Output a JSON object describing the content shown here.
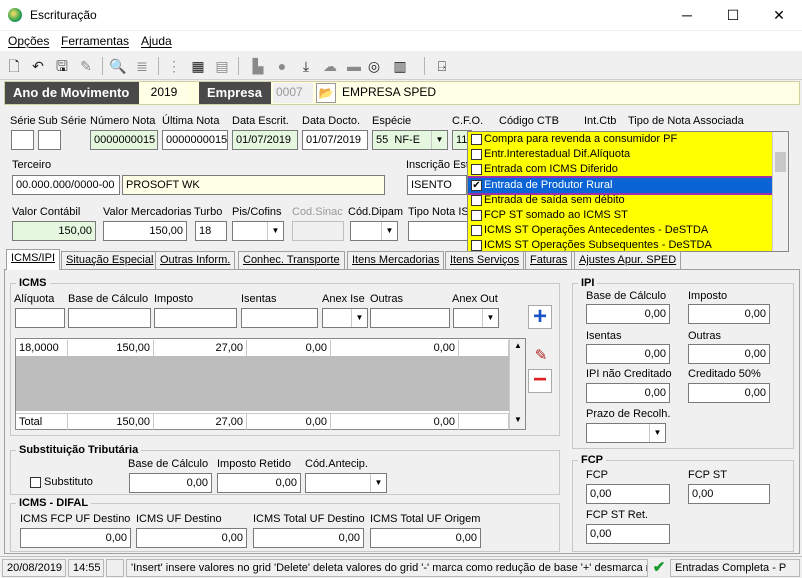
{
  "window": {
    "title": "Escrituração",
    "minimize": "─",
    "maximize": "☐",
    "close": "✕"
  },
  "menu": [
    "Opções",
    "Ferramentas",
    "Ajuda"
  ],
  "year_bar": {
    "ano_label": "Ano de Movimento",
    "ano_value": "2019",
    "empresa_label": "Empresa",
    "empresa_code": "0007",
    "empresa_name": "EMPRESA SPED"
  },
  "header": {
    "serie_label": "Série",
    "subserie_label": "Sub Série",
    "numero_nota_label": "Número Nota",
    "numero_nota": "0000000015",
    "ultima_nota_label": "Última Nota",
    "ultima_nota": "0000000015",
    "data_escrit_label": "Data Escrit.",
    "data_escrit": "01/07/2019",
    "data_docto_label": "Data Docto.",
    "data_docto": "01/07/2019",
    "especie_label": "Espécie",
    "especie_code": "55",
    "especie_name": "NF-E",
    "cfo_label": "C.F.O.",
    "cfo_value": "11",
    "codigo_ctb_label": "Código CTB",
    "int_ctb_label": "Int.Ctb",
    "tipo_nota_label": "Tipo de Nota Associada",
    "terceiro_label": "Terceiro",
    "terceiro_cnpj": "00.000.000/0000-00",
    "terceiro_name": "PROSOFT WK",
    "inscricao_label": "Inscrição Est",
    "inscricao_value": "ISENTO",
    "valor_contabil_label": "Valor Contábil",
    "valor_contabil": "150,00",
    "valor_mercadorias_label": "Valor Mercadorias",
    "valor_mercadorias": "150,00",
    "turbo_label": "Turbo",
    "turbo_value": "18",
    "pis_cofins_label": "Pis/Cofins",
    "cod_sinac_label": "Cod.Sinac",
    "cod_dipam_label": "Cód.Dipam",
    "tipo_nota_is_label": "Tipo Nota IS"
  },
  "dropdown": {
    "items": [
      {
        "label": "Compra para revenda a consumidor PF",
        "checked": false
      },
      {
        "label": "Entr.Interestadual Dif.Alíquota",
        "checked": false
      },
      {
        "label": "Entrada com ICMS Diferido",
        "checked": false
      },
      {
        "label": "Entrada de Produtor Rural",
        "checked": true,
        "selected": true
      },
      {
        "label": "Entrada de saída sem débito",
        "checked": false
      },
      {
        "label": "FCP ST somado ao ICMS ST",
        "checked": false
      },
      {
        "label": "ICMS ST Operações Antecedentes - DeSTDA",
        "checked": false
      },
      {
        "label": "ICMS ST Operações Subsequentes - DeSTDA",
        "checked": false
      }
    ]
  },
  "tabs": [
    "ICMS/IPI",
    "Situação Especial",
    "Outras Inform.",
    "Conhec. Transporte",
    "Itens Mercadorias",
    "Itens Serviços",
    "Faturas",
    "Ajustes Apur. SPED"
  ],
  "icms": {
    "title": "ICMS",
    "headers": [
      "Alíquota",
      "Base de Cálculo",
      "Imposto",
      "Isentas",
      "Anex Ise",
      "Outras",
      "Anex Out"
    ],
    "row": [
      "18,0000",
      "150,00",
      "27,00",
      "0,00",
      "0,00",
      ""
    ],
    "total_label": "Total",
    "total_row": [
      "150,00",
      "27,00",
      "0,00",
      "0,00",
      ""
    ],
    "add_icon": "+",
    "remove_icon": "−"
  },
  "st": {
    "title": "Substituição Tributária",
    "substituto_label": "Substituto",
    "base_label": "Base de Cálculo",
    "base_value": "0,00",
    "imposto_label": "Imposto Retido",
    "imposto_value": "0,00",
    "cod_antecip_label": "Cód.Antecip."
  },
  "difal": {
    "title": "ICMS - DIFAL",
    "fcp_uf_destino_label": "ICMS FCP UF Destino",
    "fcp_uf_destino": "0,00",
    "uf_destino_label": "ICMS UF Destino",
    "uf_destino": "0,00",
    "total_uf_destino_label": "ICMS Total UF Destino",
    "total_uf_destino": "0,00",
    "total_uf_origem_label": "ICMS Total UF Origem",
    "total_uf_origem": "0,00"
  },
  "ipi": {
    "title": "IPI",
    "base_label": "Base de Cálculo",
    "base_value": "0,00",
    "imposto_label": "Imposto",
    "imposto_value": "0,00",
    "isentas_label": "Isentas",
    "isentas_value": "0,00",
    "outras_label": "Outras",
    "outras_value": "0,00",
    "nao_creditado_label": "IPI não Creditado",
    "nao_creditado_value": "0,00",
    "creditado50_label": "Creditado 50%",
    "creditado50_value": "0,00",
    "prazo_label": "Prazo de Recolh."
  },
  "fcp": {
    "title": "FCP",
    "fcp_label": "FCP",
    "fcp_value": "0,00",
    "fcp_st_label": "FCP ST",
    "fcp_st_value": "0,00",
    "fcp_st_ret_label": "FCP ST Ret.",
    "fcp_st_ret_value": "0,00"
  },
  "status": {
    "date": "20/08/2019",
    "time": "14:55",
    "hint": "'Insert' insere valores no grid 'Delete' deleta valores do grid '-' marca como redução de base '+' desmarca re",
    "mode": "Entradas Completa - P"
  },
  "colors": {
    "dark_label": "#4a4a4a",
    "green_field": "#e5f8df",
    "dropdown_bg": "#ffff00",
    "selection": "#0a64d6",
    "add": "#1a54c8",
    "remove": "#e02020"
  }
}
